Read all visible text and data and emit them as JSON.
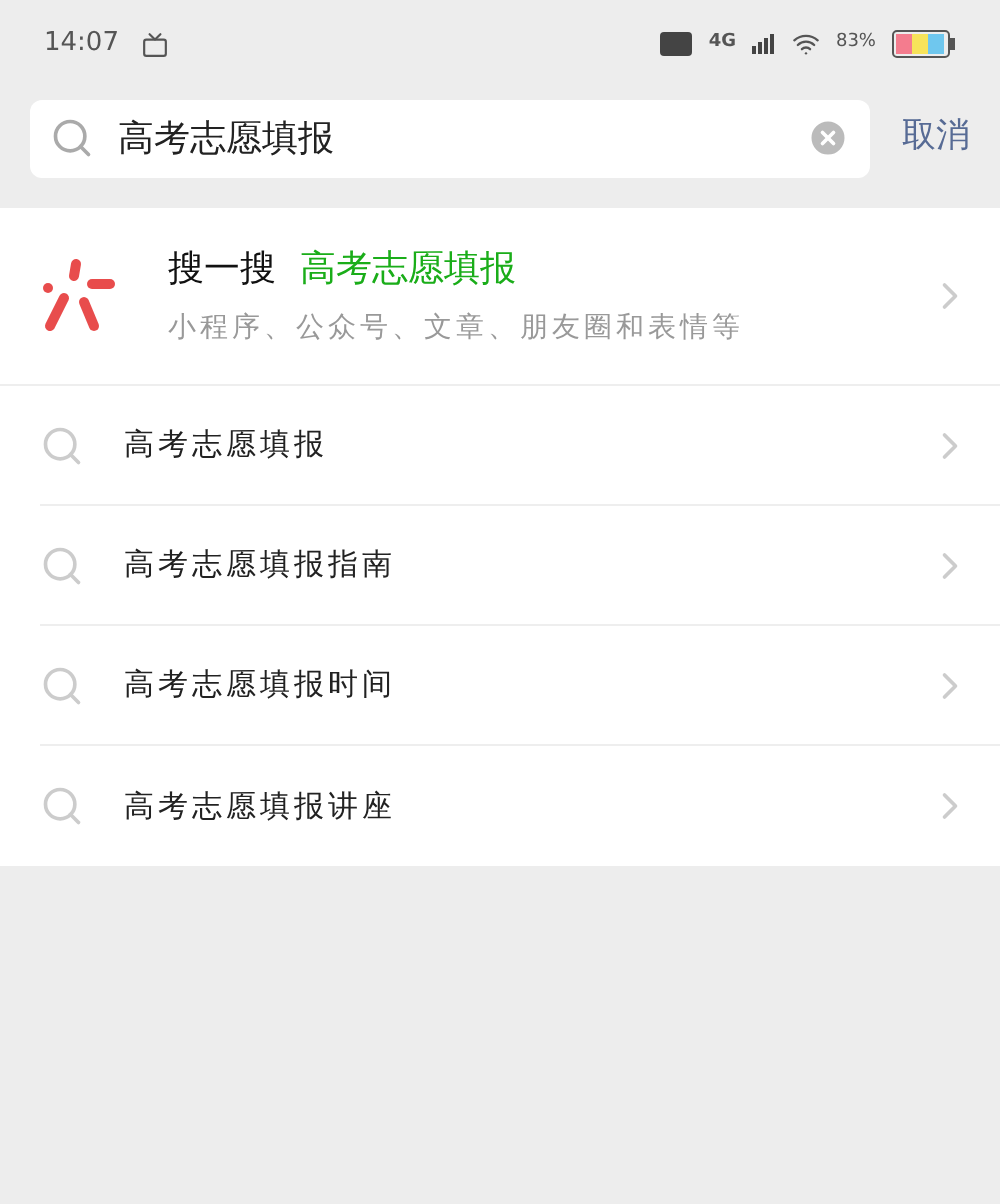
{
  "status_bar": {
    "time": "14:07",
    "network": "4G",
    "battery_text": "83%"
  },
  "search": {
    "value": "高考志愿填报",
    "cancel": "取消"
  },
  "search_one": {
    "label": "搜一搜",
    "query": "高考志愿填报",
    "subtitle": "小程序、公众号、文章、朋友圈和表情等"
  },
  "suggestions": [
    {
      "text": "高考志愿填报"
    },
    {
      "text": "高考志愿填报指南"
    },
    {
      "text": "高考志愿填报时间"
    },
    {
      "text": "高考志愿填报讲座"
    }
  ]
}
